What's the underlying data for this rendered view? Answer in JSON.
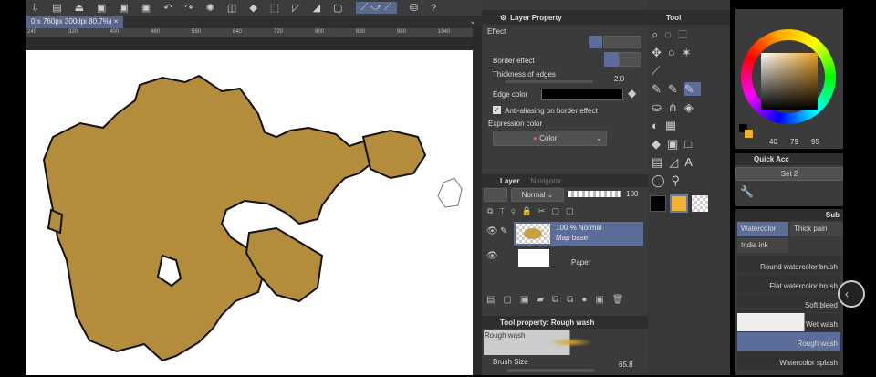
{
  "document": {
    "tab_title": "0 x 760px 300dpi 80.7%)",
    "close": "×"
  },
  "ruler": [
    "240",
    "320",
    "400",
    "480",
    "560",
    "640",
    "720",
    "800",
    "880",
    "960",
    "1040"
  ],
  "layer_property": {
    "title": "Layer Property",
    "effect_label": "Effect",
    "border_effect_label": "Border effect",
    "thickness_label": "Thickness of edges",
    "thickness_value": "2.0",
    "edge_color_label": "Edge color",
    "edge_color": "#000000",
    "antialias_label": "Anti-aliasing on border effect",
    "antialias_checked": true,
    "expression_color_label": "Expression color",
    "expression_color_value": "Color"
  },
  "layer": {
    "tab_layer": "Layer",
    "tab_navigator": "Navigator",
    "blend_mode": "Normal",
    "opacity": "100",
    "opacity_fraction": 1.0,
    "layers": [
      {
        "top": "100 % Normal",
        "name": "Map base",
        "selected": true
      },
      {
        "top": "",
        "name": "Paper",
        "selected": false
      }
    ]
  },
  "tool_property": {
    "title": "Tool property: Rough wash",
    "preview_label": "Rough wash",
    "brush_size_label": "Brush Size",
    "brush_size_value": "65.8"
  },
  "tool": {
    "title": "Tool",
    "main_color": "#000000",
    "sub_color": "#f0b030"
  },
  "color": {
    "h": "40",
    "s": "79",
    "v": "95",
    "current": "#e8a93a"
  },
  "quick_access": {
    "title": "Quick Acc",
    "set": "Set 2"
  },
  "sub_tool": {
    "title": "Sub",
    "groups": [
      "Watercolor",
      "Thick pain",
      "India ink"
    ],
    "brushes": [
      "Round watercolor brush",
      "Flat watercolor brush",
      "Soft bleed",
      "Wet wash",
      "Rough wash",
      "Watercolor splash"
    ],
    "selected": "Rough wash"
  }
}
